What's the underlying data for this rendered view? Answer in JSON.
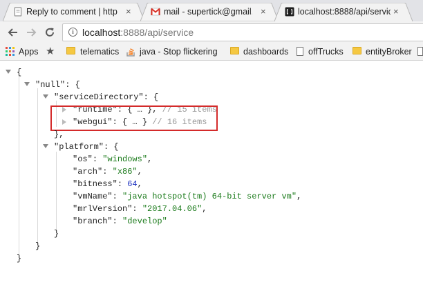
{
  "tabs": [
    {
      "title": "Reply to comment | http",
      "icon": "document-icon",
      "active": false
    },
    {
      "title": "mail - supertick@gmail.c",
      "icon": "gmail-icon",
      "active": false
    },
    {
      "title": "localhost:8888/api/servic",
      "icon": "json-viewer-icon",
      "active": true
    }
  ],
  "toolbar": {
    "url_host": "localhost",
    "url_rest": ":8888/api/service"
  },
  "bookmarks": [
    {
      "label": "Apps",
      "icon": "apps-grid-icon"
    },
    {
      "label": "",
      "icon": "star-icon"
    },
    {
      "label": "telematics",
      "icon": "folder-icon"
    },
    {
      "label": "java - Stop flickering",
      "icon": "stackoverflow-icon"
    },
    {
      "label": "dashboards",
      "icon": "folder-icon"
    },
    {
      "label": "offTrucks",
      "icon": "page-icon"
    },
    {
      "label": "entityBroker",
      "icon": "folder-icon"
    }
  ],
  "json": {
    "open_brace": "{",
    "null_key": "\"null\"",
    "service_dir_key": "\"serviceDirectory\"",
    "runtime_key": "\"runtime\"",
    "runtime_summary": "{ … }",
    "runtime_comment": "// 15 items",
    "webgui_key": "\"webgui\"",
    "webgui_summary": "{ … }",
    "webgui_comment": "// 16 items",
    "platform_key": "\"platform\"",
    "os_key": "\"os\"",
    "os_val": "\"windows\"",
    "arch_key": "\"arch\"",
    "arch_val": "\"x86\"",
    "bitness_key": "\"bitness\"",
    "bitness_val": "64",
    "vmname_key": "\"vmName\"",
    "vmname_val": "\"java hotspot(tm) 64-bit server vm\"",
    "mrl_key": "\"mrlVersion\"",
    "mrl_val": "\"2017.04.06\"",
    "branch_key": "\"branch\"",
    "branch_val": "\"develop\""
  },
  "colors": {
    "string": "#1a7a1a",
    "number": "#1b2fbf",
    "comment": "#999999",
    "highlight_box": "#d42a2a"
  }
}
